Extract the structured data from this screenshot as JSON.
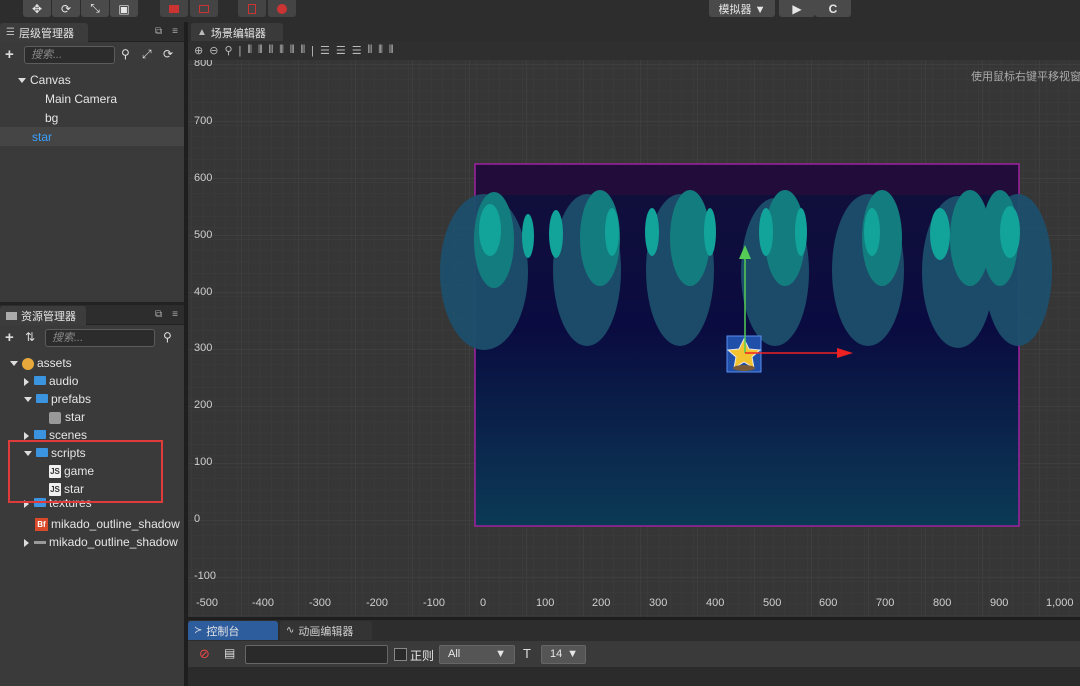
{
  "toolbar": {
    "simulator_label": "模拟器 ▼",
    "play_glyph": "▶",
    "refresh_glyph": "C"
  },
  "hierarchy": {
    "title": "层级管理器",
    "search_placeholder": "搜索...",
    "items": [
      {
        "label": "Canvas",
        "expanded": true
      },
      {
        "label": "Main Camera"
      },
      {
        "label": "bg"
      },
      {
        "label": "star",
        "selected": true
      }
    ]
  },
  "assets": {
    "title": "资源管理器",
    "search_placeholder": "搜索...",
    "items": [
      {
        "label": "assets",
        "icon": "database-icon"
      },
      {
        "label": "audio",
        "icon": "folder-icon"
      },
      {
        "label": "prefabs",
        "icon": "folder-icon"
      },
      {
        "label": "star",
        "icon": "prefab-icon"
      },
      {
        "label": "scenes",
        "icon": "folder-icon"
      },
      {
        "label": "scripts",
        "icon": "folder-icon"
      },
      {
        "label": "game",
        "icon": "js-icon"
      },
      {
        "label": "star",
        "icon": "js-icon"
      },
      {
        "label": "textures",
        "icon": "folder-icon"
      },
      {
        "label": "mikado_outline_shadow",
        "icon": "bitmap-font-icon"
      },
      {
        "label": "mikado_outline_shadow",
        "icon": "font-icon"
      }
    ],
    "highlight_color": "#e03b3b"
  },
  "scene": {
    "tab_title": "场景编辑器",
    "hint": "使用鼠标右键平移视窗",
    "y_labels": [
      "800",
      "700",
      "600",
      "500",
      "400",
      "300",
      "200",
      "100",
      "0",
      "-100"
    ],
    "x_labels": [
      "-500",
      "-400",
      "-300",
      "-200",
      "-100",
      "0",
      "100",
      "200",
      "300",
      "400",
      "500",
      "600",
      "700",
      "800",
      "900",
      "1,000"
    ],
    "colors": {
      "canvas_border": "#a020a0",
      "gizmo_x": "#ee2222",
      "gizmo_y": "#55cc55",
      "selection": "#3a7bd5"
    }
  },
  "console": {
    "tab_console": "控制台",
    "tab_animation": "动画编辑器",
    "regex_label": "正则",
    "filter_value": "All",
    "font_size_value": "14"
  }
}
